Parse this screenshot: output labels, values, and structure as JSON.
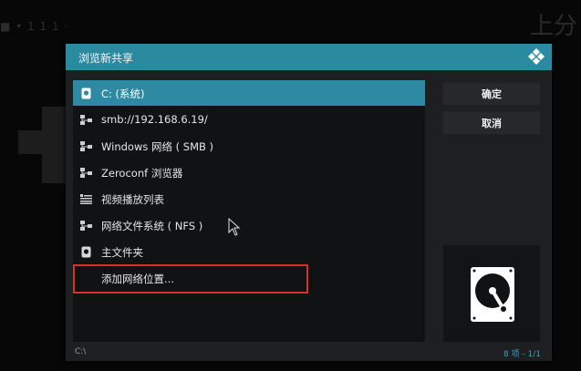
{
  "background": {
    "top_left_text": "■ • 1 1 1 ·",
    "top_right_text": "上分"
  },
  "dialog": {
    "title": "浏览新共享",
    "logo_icon": "kodi-logo-icon",
    "accent_color": "#2a8aa0"
  },
  "sources": [
    {
      "label": "C: (系统)",
      "icon": "drive-icon",
      "selected": true
    },
    {
      "label": "smb://192.168.6.19/",
      "icon": "network-icon",
      "selected": false
    },
    {
      "label": "Windows 网络 ( SMB )",
      "icon": "network-icon",
      "selected": false
    },
    {
      "label": "Zeroconf 浏览器",
      "icon": "network-icon",
      "selected": false
    },
    {
      "label": "视频播放列表",
      "icon": "playlist-icon",
      "selected": false
    },
    {
      "label": "网络文件系统 ( NFS )",
      "icon": "network-icon",
      "selected": false
    },
    {
      "label": "主文件夹",
      "icon": "drive-icon",
      "selected": false
    },
    {
      "label": "添加网络位置...",
      "icon": "",
      "selected": false
    }
  ],
  "buttons": {
    "ok": "确定",
    "cancel": "取消"
  },
  "preview": {
    "icon": "hard-disk-icon"
  },
  "footer": {
    "path": "C:\\",
    "count": "8 项 - 1/1"
  }
}
